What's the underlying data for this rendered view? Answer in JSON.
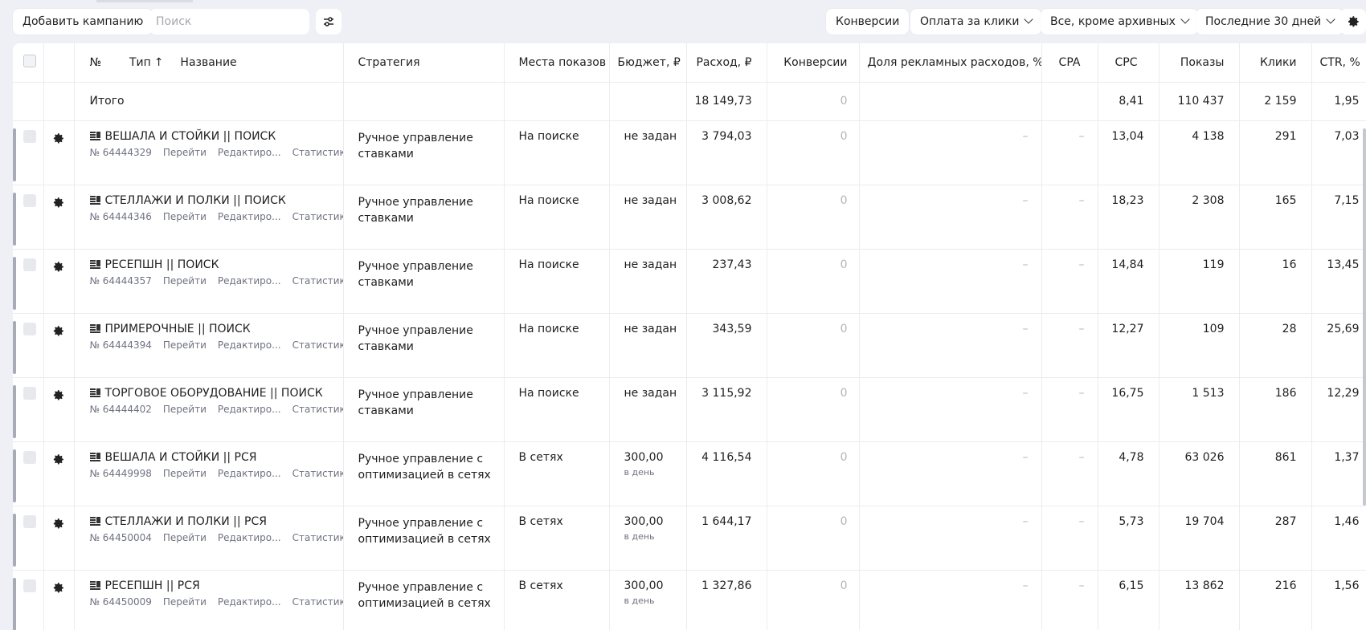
{
  "toolbar": {
    "add_campaign": "Добавить кампанию",
    "search_placeholder": "Поиск",
    "conversions": "Конверсии",
    "payment": "Оплата за клики",
    "status_filter": "Все, кроме архивных",
    "period": "Последние 30 дней"
  },
  "columns": {
    "num": "№",
    "type": "Тип",
    "name": "Название",
    "strategy": "Стратегия",
    "placements": "Места показов",
    "budget": "Бюджет, ₽",
    "spend": "Расход, ₽",
    "conversions": "Конверсии",
    "ad_cost_share": "Доля рекламных расходов, %",
    "cpa": "CPA",
    "cpc": "CPC",
    "impressions": "Показы",
    "clicks": "Клики",
    "ctr": "CTR, %"
  },
  "total": {
    "label": "Итого",
    "spend": "18 149,73",
    "conversions": "0",
    "cpc": "8,41",
    "impressions": "110 437",
    "clicks": "2 159",
    "ctr": "1,95"
  },
  "row_links": {
    "go": "Перейти",
    "edit": "Редактиро...",
    "stats": "Статистика"
  },
  "campaigns": [
    {
      "name": "ВЕШАЛА И СТОЙКИ || ПОИСК",
      "id": "№ 64444329",
      "strategy": "Ручное управление ставками",
      "placement": "На поиске",
      "budget": "не задан",
      "budget_sub": "",
      "spend": "3 794,03",
      "conversions": "0",
      "ad_cost_share": "–",
      "cpa": "–",
      "cpc": "13,04",
      "impressions": "4 138",
      "clicks": "291",
      "ctr": "7,03"
    },
    {
      "name": "СТЕЛЛАЖИ И ПОЛКИ || ПОИСК",
      "id": "№ 64444346",
      "strategy": "Ручное управление ставками",
      "placement": "На поиске",
      "budget": "не задан",
      "budget_sub": "",
      "spend": "3 008,62",
      "conversions": "0",
      "ad_cost_share": "–",
      "cpa": "–",
      "cpc": "18,23",
      "impressions": "2 308",
      "clicks": "165",
      "ctr": "7,15"
    },
    {
      "name": "РЕСЕПШН || ПОИСК",
      "id": "№ 64444357",
      "strategy": "Ручное управление ставками",
      "placement": "На поиске",
      "budget": "не задан",
      "budget_sub": "",
      "spend": "237,43",
      "conversions": "0",
      "ad_cost_share": "–",
      "cpa": "–",
      "cpc": "14,84",
      "impressions": "119",
      "clicks": "16",
      "ctr": "13,45"
    },
    {
      "name": "ПРИМЕРОЧНЫЕ || ПОИСК",
      "id": "№ 64444394",
      "strategy": "Ручное управление ставками",
      "placement": "На поиске",
      "budget": "не задан",
      "budget_sub": "",
      "spend": "343,59",
      "conversions": "0",
      "ad_cost_share": "–",
      "cpa": "–",
      "cpc": "12,27",
      "impressions": "109",
      "clicks": "28",
      "ctr": "25,69"
    },
    {
      "name": "ТОРГОВОЕ ОБОРУДОВАНИЕ || ПОИСК",
      "id": "№ 64444402",
      "strategy": "Ручное управление ставками",
      "placement": "На поиске",
      "budget": "не задан",
      "budget_sub": "",
      "spend": "3 115,92",
      "conversions": "0",
      "ad_cost_share": "–",
      "cpa": "–",
      "cpc": "16,75",
      "impressions": "1 513",
      "clicks": "186",
      "ctr": "12,29"
    },
    {
      "name": "ВЕШАЛА И СТОЙКИ || РСЯ",
      "id": "№ 64449998",
      "strategy": "Ручное управление с оптимизацией в сетях",
      "placement": "В сетях",
      "budget": "300,00",
      "budget_sub": "в день",
      "spend": "4 116,54",
      "conversions": "0",
      "ad_cost_share": "–",
      "cpa": "–",
      "cpc": "4,78",
      "impressions": "63 026",
      "clicks": "861",
      "ctr": "1,37"
    },
    {
      "name": "СТЕЛЛАЖИ И ПОЛКИ || РСЯ",
      "id": "№ 64450004",
      "strategy": "Ручное управление с оптимизацией в сетях",
      "placement": "В сетях",
      "budget": "300,00",
      "budget_sub": "в день",
      "spend": "1 644,17",
      "conversions": "0",
      "ad_cost_share": "–",
      "cpa": "–",
      "cpc": "5,73",
      "impressions": "19 704",
      "clicks": "287",
      "ctr": "1,46"
    },
    {
      "name": "РЕСЕПШН || РСЯ",
      "id": "№ 64450009",
      "strategy": "Ручное управление с оптимизацией в сетях",
      "placement": "В сетях",
      "budget": "300,00",
      "budget_sub": "в день",
      "spend": "1 327,86",
      "conversions": "0",
      "ad_cost_share": "–",
      "cpa": "–",
      "cpc": "6,15",
      "impressions": "13 862",
      "clicks": "216",
      "ctr": "1,56"
    }
  ]
}
